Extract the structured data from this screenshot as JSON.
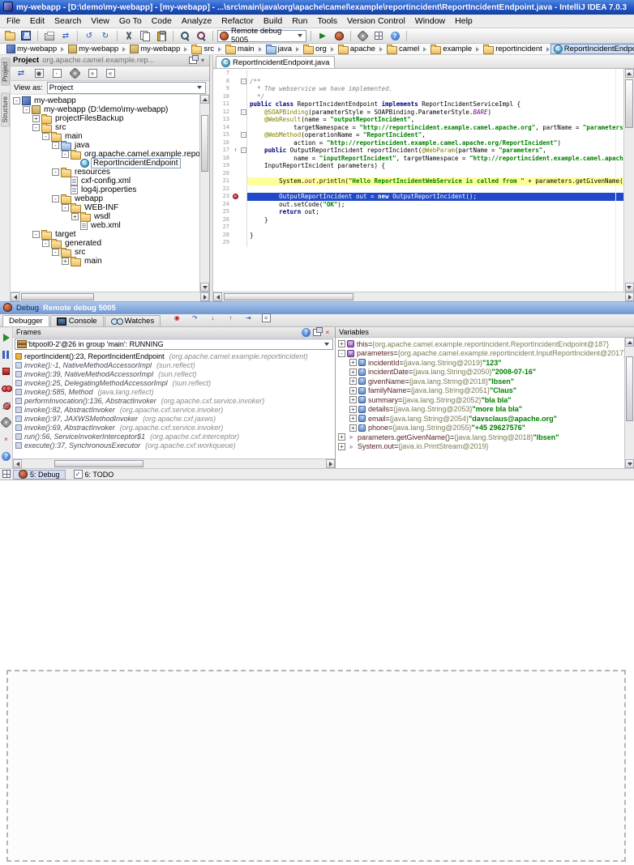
{
  "colors": {
    "execution_line": "#2148c8",
    "highlight_line": "#ffff99",
    "breakpoint": "#b41212",
    "string": "#008000",
    "keyword": "#000080"
  },
  "glyphs": {
    "plus": "+",
    "minus": "-"
  },
  "window": {
    "title": "my-webapp - [D:\\demo\\my-webapp] - [my-webapp] - ...\\src\\main\\java\\org\\apache\\camel\\example\\reportincident\\ReportIncidentEndpoint.java - IntelliJ IDEA 7.0.3"
  },
  "menu_bar": {
    "items": [
      "File",
      "Edit",
      "Search",
      "View",
      "Go To",
      "Code",
      "Analyze",
      "Refactor",
      "Build",
      "Run",
      "Tools",
      "Version Control",
      "Window",
      "Help"
    ]
  },
  "toolbar": {
    "groups_before": [
      [
        "open-icon",
        "save-icon"
      ],
      [
        "print-icon",
        "sync-icon"
      ],
      [
        "undo-icon",
        "redo-icon"
      ],
      [
        "cut-icon",
        "copy-icon",
        "paste-icon"
      ],
      [
        "find-icon",
        "replace-icon"
      ]
    ],
    "run_config": {
      "icon": "debug-config-icon",
      "value": "Remote debug 5005"
    },
    "groups_after": [
      [
        "run-icon",
        "debug-icon"
      ],
      [
        "settings-icon",
        "project-structure-icon",
        "help-icon"
      ]
    ]
  },
  "navbar": {
    "items": [
      {
        "label": "my-webapp",
        "icon": "project-icon"
      },
      {
        "label": "my-webapp",
        "icon": "module-icon"
      },
      {
        "label": "my-webapp",
        "icon": "module-icon"
      },
      {
        "label": "src",
        "icon": "folder-icon"
      },
      {
        "label": "main",
        "icon": "folder-icon"
      },
      {
        "label": "java",
        "icon": "source-folder-icon"
      },
      {
        "label": "org",
        "icon": "package-icon"
      },
      {
        "label": "apache",
        "icon": "package-icon"
      },
      {
        "label": "camel",
        "icon": "package-icon"
      },
      {
        "label": "example",
        "icon": "package-icon"
      },
      {
        "label": "reportincident",
        "icon": "package-icon"
      },
      {
        "label": "ReportIncidentEndpoint",
        "icon": "class-icon",
        "selected": true
      }
    ]
  },
  "tool_stripes": {
    "left": [
      "Project",
      "Structure"
    ]
  },
  "project_panel": {
    "title": "Project",
    "subtitle": "org.apache.camel.example.rep...",
    "window_icons": [
      "float-icon",
      "hide-icon"
    ],
    "toolbar_icons": [
      "sync-icon",
      "select-target-icon",
      "collapse-all-icon",
      "settings-icon",
      "autoscroll-to-source-icon",
      "autoscroll-from-source-icon"
    ],
    "view_as_label": "View as:",
    "view_as_value": "Project",
    "tree": [
      {
        "d": 0,
        "e": "minus",
        "i": "project-icon",
        "t": "my-webapp"
      },
      {
        "d": 1,
        "e": "minus",
        "i": "module-icon",
        "t": "my-webapp (D:\\demo\\my-webapp)"
      },
      {
        "d": 2,
        "e": "plus",
        "i": "folder-icon",
        "t": "projectFilesBackup"
      },
      {
        "d": 2,
        "e": "minus",
        "i": "folder-icon",
        "t": "src"
      },
      {
        "d": 3,
        "e": "minus",
        "i": "folder-icon",
        "t": "main"
      },
      {
        "d": 4,
        "e": "minus",
        "i": "source-folder-icon",
        "t": "java"
      },
      {
        "d": 5,
        "e": "minus",
        "i": "package-icon",
        "t": "org.apache.camel.example.reportincident"
      },
      {
        "d": 6,
        "e": "none",
        "i": "class-icon",
        "t": "ReportIncidentEndpoint",
        "sel": true
      },
      {
        "d": 4,
        "e": "minus",
        "i": "folder-icon",
        "t": "resources"
      },
      {
        "d": 5,
        "e": "none",
        "i": "xml-file-icon",
        "t": "cxf-config.xml"
      },
      {
        "d": 5,
        "e": "none",
        "i": "properties-file-icon",
        "t": "log4j.properties"
      },
      {
        "d": 4,
        "e": "minus",
        "i": "folder-icon",
        "t": "webapp"
      },
      {
        "d": 5,
        "e": "minus",
        "i": "folder-icon",
        "t": "WEB-INF"
      },
      {
        "d": 6,
        "e": "plus",
        "i": "folder-icon",
        "t": "wsdl"
      },
      {
        "d": 6,
        "e": "none",
        "i": "xml-file-icon",
        "t": "web.xml"
      },
      {
        "d": 2,
        "e": "minus",
        "i": "folder-icon",
        "t": "target"
      },
      {
        "d": 3,
        "e": "minus",
        "i": "folder-icon",
        "t": "generated"
      },
      {
        "d": 4,
        "e": "minus",
        "i": "folder-icon",
        "t": "src"
      },
      {
        "d": 5,
        "e": "plus",
        "i": "folder-icon",
        "t": "main"
      }
    ]
  },
  "editor": {
    "tab": {
      "icon": "class-icon",
      "label": "ReportIncidentEndpoint.java"
    },
    "lines": [
      {
        "n": "7",
        "segs": []
      },
      {
        "n": "8",
        "fold": "minus",
        "segs": [
          [
            "c",
            "/**"
          ]
        ]
      },
      {
        "n": "9",
        "segs": [
          [
            "c",
            "  * The webservice we have implemented."
          ]
        ]
      },
      {
        "n": "10",
        "segs": [
          [
            "c",
            "  */"
          ]
        ]
      },
      {
        "n": "11",
        "segs": [
          [
            "k",
            "public class "
          ],
          [
            "p",
            "ReportIncidentEndpoint "
          ],
          [
            "k",
            "implements "
          ],
          [
            "p",
            "ReportIncidentServiceImpl {"
          ]
        ]
      },
      {
        "n": "12",
        "fold": "minus",
        "segs": [
          [
            "p",
            "    "
          ],
          [
            "a",
            "@SOAPBinding"
          ],
          [
            "p",
            "(parameterStyle = SOAPBinding.ParameterStyle."
          ],
          [
            "f",
            "BARE"
          ],
          [
            "p",
            ")"
          ]
        ]
      },
      {
        "n": "13",
        "segs": [
          [
            "p",
            "    "
          ],
          [
            "a",
            "@WebResult"
          ],
          [
            "p",
            "(name = "
          ],
          [
            "s",
            "\"outputReportIncident\""
          ],
          [
            "p",
            ","
          ]
        ]
      },
      {
        "n": "14",
        "segs": [
          [
            "p",
            "            targetNamespace = "
          ],
          [
            "s",
            "\"http://reportincident.example.camel.apache.org\""
          ],
          [
            "p",
            ", partName = "
          ],
          [
            "s",
            "\"parameters\""
          ],
          [
            "p",
            ")"
          ]
        ]
      },
      {
        "n": "15",
        "fold": "minus",
        "segs": [
          [
            "p",
            "    "
          ],
          [
            "a",
            "@WebMethod"
          ],
          [
            "p",
            "(operationName = "
          ],
          [
            "s",
            "\"ReportIncident\""
          ],
          [
            "p",
            ","
          ]
        ]
      },
      {
        "n": "16",
        "segs": [
          [
            "p",
            "            action = "
          ],
          [
            "s",
            "\"http://reportincident.example.camel.apache.org/ReportIncident\""
          ],
          [
            "p",
            ")"
          ]
        ]
      },
      {
        "n": "17",
        "fold": "minus",
        "marker": "implement",
        "segs": [
          [
            "k",
            "    public "
          ],
          [
            "p",
            "OutputReportIncident reportIncident("
          ],
          [
            "a",
            "@WebParam"
          ],
          [
            "p",
            "(partName = "
          ],
          [
            "s",
            "\"parameters\""
          ],
          [
            "p",
            ","
          ]
        ]
      },
      {
        "n": "18",
        "segs": [
          [
            "p",
            "            name = "
          ],
          [
            "s",
            "\"inputReportIncident\""
          ],
          [
            "p",
            ", targetNamespace = "
          ],
          [
            "s",
            "\"http://reportincident.example.camel.apache.org\""
          ],
          [
            "p",
            ")"
          ]
        ]
      },
      {
        "n": "19",
        "segs": [
          [
            "p",
            "    InputReportIncident parameters) {"
          ]
        ]
      },
      {
        "n": "20",
        "segs": []
      },
      {
        "n": "21",
        "bg": "hl",
        "segs": [
          [
            "p",
            "        System."
          ],
          [
            "f",
            "out"
          ],
          [
            "p",
            ".println("
          ],
          [
            "s",
            "\"Hello ReportIncidentWebService is called from \""
          ],
          [
            "p",
            " + parameters.getGivenName());"
          ]
        ]
      },
      {
        "n": "22",
        "segs": []
      },
      {
        "n": "23",
        "bg": "exec",
        "marker": "breakpoint",
        "segs": [
          [
            "w",
            "        OutputReportIncident out = "
          ],
          [
            "wk",
            "new"
          ],
          [
            "w",
            " OutputReportIncident();"
          ]
        ]
      },
      {
        "n": "24",
        "segs": [
          [
            "p",
            "        out.setCode("
          ],
          [
            "s",
            "\"OK\""
          ],
          [
            "p",
            ");"
          ]
        ]
      },
      {
        "n": "25",
        "segs": [
          [
            "k",
            "        return"
          ],
          [
            "p",
            " out;"
          ]
        ]
      },
      {
        "n": "26",
        "segs": [
          [
            "p",
            "    }"
          ]
        ]
      },
      {
        "n": "27",
        "segs": []
      },
      {
        "n": "28",
        "segs": [
          [
            "p",
            "}"
          ]
        ]
      },
      {
        "n": "29",
        "segs": []
      }
    ]
  },
  "debug": {
    "header": {
      "icon": "debug-icon",
      "label": "Debug",
      "config": "Remote debug 5005"
    },
    "tabs": [
      {
        "label": "Debugger",
        "active": true
      },
      {
        "label": "Console",
        "icon": "console-icon"
      },
      {
        "label": "Watches",
        "icon": "watches-icon"
      }
    ],
    "step_icons": [
      "show-execution-point-icon",
      "step-over-icon",
      "step-into-icon",
      "step-out-icon",
      "run-to-cursor-icon",
      "evaluate-expression-icon"
    ],
    "left_toolbar": [
      "resume-icon",
      "pause-icon",
      "stop-icon",
      "view-breakpoints-icon",
      "mute-breakpoints-icon",
      "settings-icon",
      "close-icon",
      "help-icon"
    ],
    "frames": {
      "title": "Frames",
      "header_icons": [
        "help-icon",
        "float-icon",
        "close-icon"
      ],
      "thread": "'btpool0-2'@26 in group 'main': RUNNING",
      "rows": [
        {
          "label": "reportIncident():23, ReportIncidentEndpoint",
          "pkg": "(org.apache.camel.example.reportincident)",
          "style": "user"
        },
        {
          "label": "invoke():-1, NativeMethodAccessorImpl",
          "pkg": "(sun.reflect)",
          "style": "lib"
        },
        {
          "label": "invoke():39, NativeMethodAccessorImpl",
          "pkg": "(sun.reflect)",
          "style": "lib"
        },
        {
          "label": "invoke():25, DelegatingMethodAccessorImpl",
          "pkg": "(sun.reflect)",
          "style": "lib"
        },
        {
          "label": "invoke():585, Method",
          "pkg": "(java.lang.reflect)",
          "style": "lib"
        },
        {
          "label": "performInvocation():136, AbstractInvoker",
          "pkg": "(org.apache.cxf.service.invoker)",
          "style": "lib"
        },
        {
          "label": "invoke():82, AbstractInvoker",
          "pkg": "(org.apache.cxf.service.invoker)",
          "style": "lib"
        },
        {
          "label": "invoke():97, JAXWSMethodInvoker",
          "pkg": "(org.apache.cxf.jaxws)",
          "style": "lib"
        },
        {
          "label": "invoke():69, AbstractInvoker",
          "pkg": "(org.apache.cxf.service.invoker)",
          "style": "lib"
        },
        {
          "label": "run():56, ServiceInvokerInterceptor$1",
          "pkg": "(org.apache.cxf.interceptor)",
          "style": "lib"
        },
        {
          "label": "execute():37, SynchronousExecutor",
          "pkg": "(org.apache.cxf.workqueue)",
          "style": "lib"
        }
      ]
    },
    "variables": {
      "title": "Variables",
      "sep": " = ",
      "rows": [
        {
          "d": 0,
          "e": "plus",
          "i": "value-icon",
          "n": "this",
          "r": "{org.apache.camel.example.reportincident.ReportIncidentEndpoint@187}"
        },
        {
          "d": 0,
          "e": "minus",
          "i": "value-icon",
          "n": "parameters",
          "r": "{org.apache.camel.example.reportincident.InputReportIncident@2017}"
        },
        {
          "d": 1,
          "e": "plus",
          "i": "field-icon",
          "n": "incidentId",
          "r": "{java.lang.String@2019}",
          "v": "\"123\""
        },
        {
          "d": 1,
          "e": "plus",
          "i": "field-icon",
          "n": "incidentDate",
          "r": "{java.lang.String@2050}",
          "v": "\"2008-07-16\""
        },
        {
          "d": 1,
          "e": "plus",
          "i": "field-icon",
          "n": "givenName",
          "r": "{java.lang.String@2018}",
          "v": "\"Ibsen\""
        },
        {
          "d": 1,
          "e": "plus",
          "i": "field-icon",
          "n": "familyName",
          "r": "{java.lang.String@2051}",
          "v": "\"Claus\""
        },
        {
          "d": 1,
          "e": "plus",
          "i": "field-icon",
          "n": "summary",
          "r": "{java.lang.String@2052}",
          "v": "\"bla bla\""
        },
        {
          "d": 1,
          "e": "plus",
          "i": "field-icon",
          "n": "details",
          "r": "{java.lang.String@2053}",
          "v": "\"more bla bla\""
        },
        {
          "d": 1,
          "e": "plus",
          "i": "field-icon",
          "n": "email",
          "r": "{java.lang.String@2054}",
          "v": "\"davsclaus@apache.org\""
        },
        {
          "d": 1,
          "e": "plus",
          "i": "field-icon",
          "n": "phone",
          "r": "{java.lang.String@2055}",
          "v": "\"+45 29627576\""
        },
        {
          "d": 0,
          "e": "plus",
          "i": "watch-icon",
          "n": "parameters.getGivenName()",
          "r": "{java.lang.String@2018}",
          "v": "\"Ibsen\""
        },
        {
          "d": 0,
          "e": "plus",
          "i": "watch-icon",
          "n": "System.out",
          "r": "{java.io.PrintStream@2019}"
        }
      ]
    }
  },
  "bottom_bar": {
    "toggle_icon": "windows-icon",
    "tabs": [
      {
        "label": "5: Debug",
        "icon": "debug-icon",
        "active": true
      },
      {
        "label": "6: TODO",
        "icon": "todo-icon",
        "active": false
      }
    ]
  }
}
